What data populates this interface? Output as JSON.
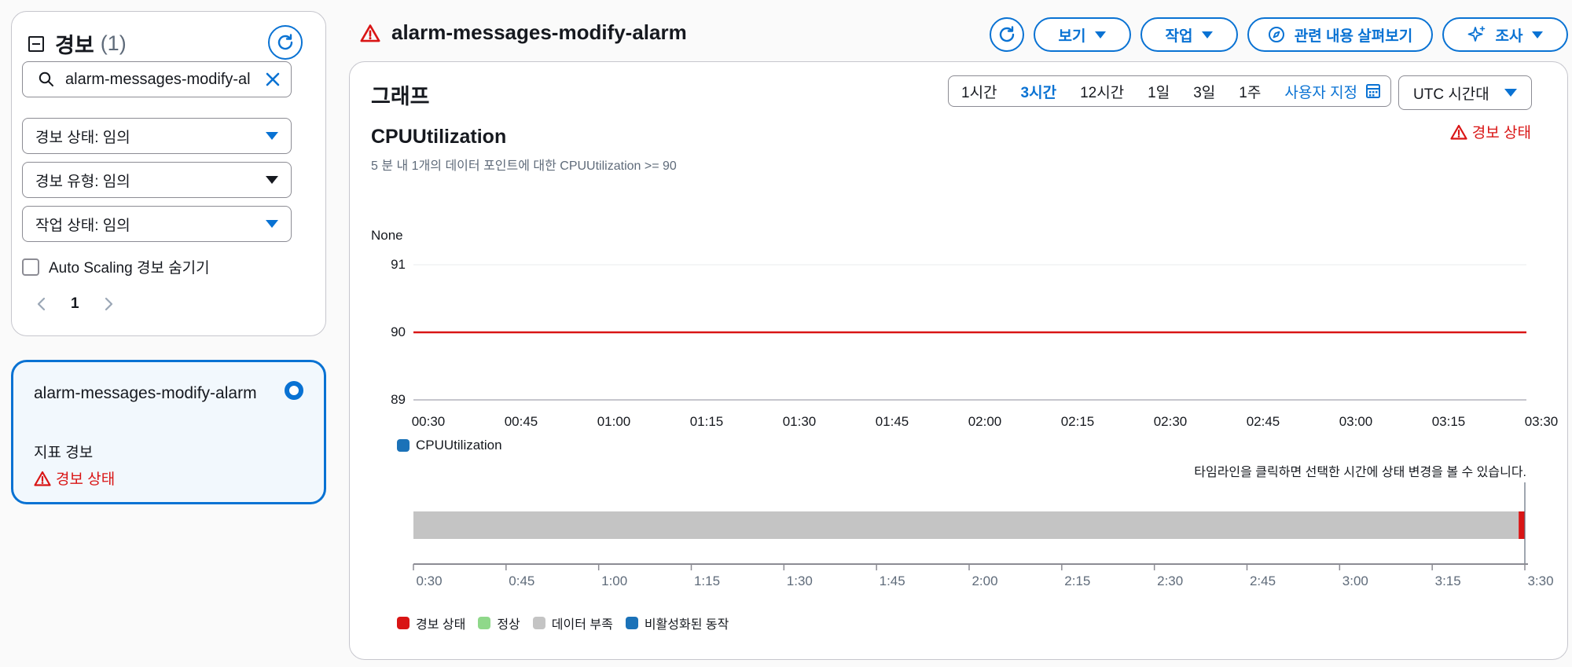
{
  "sidebar": {
    "title": "경보",
    "count": "(1)",
    "search_value": "alarm-messages-modify-al",
    "filters": [
      {
        "label": "경보 상태: 임의"
      },
      {
        "label": "경보 유형: 임의"
      },
      {
        "label": "작업 상태: 임의"
      }
    ],
    "hide_autoscaling_label": "Auto Scaling 경보 숨기기",
    "page_number": "1",
    "alarm_card": {
      "name": "alarm-messages-modify-alarm",
      "type": "지표 경보",
      "status": "경보 상태"
    }
  },
  "header": {
    "title": "alarm-messages-modify-alarm",
    "buttons": {
      "view": "보기",
      "actions": "작업",
      "related": "관련 내용 살펴보기",
      "investigate": "조사"
    }
  },
  "graph": {
    "title": "그래프",
    "ranges": [
      "1시간",
      "3시간",
      "12시간",
      "1일",
      "3일",
      "1주"
    ],
    "active_range": "3시간",
    "custom_label": "사용자 지정",
    "timezone": "UTC 시간대",
    "metric_name": "CPUUtilization",
    "metric_description": "5 분 내 1개의 데이터 포인트에 대한 CPUUtilization >= 90",
    "state_label": "경보 상태",
    "unit_label": "None",
    "legend_series": "CPUUtilization",
    "timeline_hint": "타임라인을 클릭하면 선택한 시간에 상태 변경을 볼 수 있습니다.",
    "timeline_legend": [
      {
        "label": "경보 상태",
        "color": "#d91515"
      },
      {
        "label": "정상",
        "color": "#8fd88a"
      },
      {
        "label": "데이터 부족",
        "color": "#c4c4c4"
      },
      {
        "label": "비활성화된 동작",
        "color": "#1b72b8"
      }
    ]
  },
  "chart_data": [
    {
      "type": "line",
      "xlabel": "",
      "ylabel": "None",
      "x_ticks": [
        "00:30",
        "00:45",
        "01:00",
        "01:15",
        "01:30",
        "01:45",
        "02:00",
        "02:15",
        "02:30",
        "02:45",
        "03:00",
        "03:15",
        "03:30"
      ],
      "y_ticks": [
        89,
        90,
        91
      ],
      "ylim": [
        89,
        91
      ],
      "series": [
        {
          "name": "CPUUtilization",
          "color": "#1b72b8",
          "values": []
        }
      ],
      "threshold": {
        "value": 90,
        "color": "#d91515"
      }
    },
    {
      "type": "bar",
      "x_ticks": [
        "0:30",
        "0:45",
        "1:00",
        "1:15",
        "1:30",
        "1:45",
        "2:00",
        "2:15",
        "2:30",
        "2:45",
        "3:00",
        "3:15",
        "3:30"
      ],
      "segments": [
        {
          "state": "데이터 부족",
          "start": "0:30",
          "end": "3:29",
          "color": "#c4c4c4"
        },
        {
          "state": "경보 상태",
          "start": "3:29",
          "end": "3:30",
          "color": "#d91515"
        }
      ]
    }
  ]
}
